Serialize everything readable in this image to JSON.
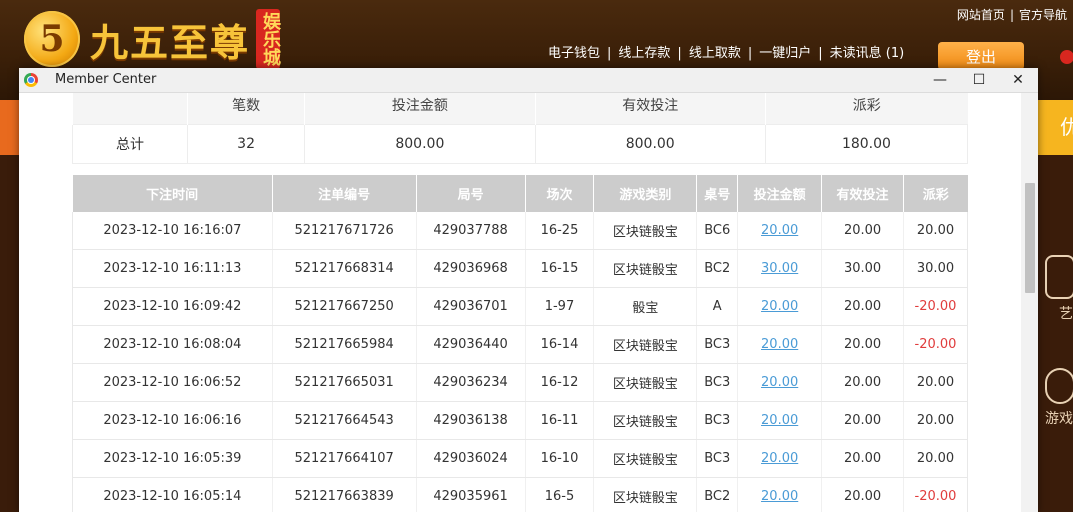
{
  "site": {
    "logo_mark": "5",
    "logo_text": "九五至尊",
    "logo_tag": "娱乐城",
    "top_links": [
      "网站首页",
      "官方导航"
    ],
    "nav_links": [
      "电子钱包",
      "线上存款",
      "线上取款",
      "一键归户",
      "未读讯息 (1)"
    ],
    "logout_label": "登出",
    "side_partial": [
      "艺",
      "游戏"
    ],
    "side_tile_char": "优"
  },
  "window": {
    "title": "Member Center",
    "minimize": "—",
    "maximize": "☐",
    "close": "✕"
  },
  "summary": {
    "headers": [
      "",
      "笔数",
      "投注金额",
      "有效投注",
      "派彩"
    ],
    "row": [
      "总计",
      "32",
      "800.00",
      "800.00",
      "180.00"
    ]
  },
  "bets": {
    "headers": [
      "下注时间",
      "注单编号",
      "局号",
      "场次",
      "游戏类别",
      "桌号",
      "投注金额",
      "有效投注",
      "派彩"
    ],
    "rows": [
      [
        "2023-12-10 16:16:07",
        "521217671726",
        "429037788",
        "16-25",
        "区块链骰宝",
        "BC6",
        "20.00",
        "20.00",
        "20.00"
      ],
      [
        "2023-12-10 16:11:13",
        "521217668314",
        "429036968",
        "16-15",
        "区块链骰宝",
        "BC2",
        "30.00",
        "30.00",
        "30.00"
      ],
      [
        "2023-12-10 16:09:42",
        "521217667250",
        "429036701",
        "1-97",
        "骰宝",
        "A",
        "20.00",
        "20.00",
        "-20.00"
      ],
      [
        "2023-12-10 16:08:04",
        "521217665984",
        "429036440",
        "16-14",
        "区块链骰宝",
        "BC3",
        "20.00",
        "20.00",
        "-20.00"
      ],
      [
        "2023-12-10 16:06:52",
        "521217665031",
        "429036234",
        "16-12",
        "区块链骰宝",
        "BC3",
        "20.00",
        "20.00",
        "20.00"
      ],
      [
        "2023-12-10 16:06:16",
        "521217664543",
        "429036138",
        "16-11",
        "区块链骰宝",
        "BC3",
        "20.00",
        "20.00",
        "20.00"
      ],
      [
        "2023-12-10 16:05:39",
        "521217664107",
        "429036024",
        "16-10",
        "区块链骰宝",
        "BC3",
        "20.00",
        "20.00",
        "20.00"
      ],
      [
        "2023-12-10 16:05:14",
        "521217663839",
        "429035961",
        "16-5",
        "区块链骰宝",
        "BC2",
        "20.00",
        "20.00",
        "-20.00"
      ]
    ]
  },
  "colors": {
    "accent_orange": "#e86a1e",
    "link_blue": "#4a9bd6",
    "negative_red": "#e03c3c",
    "header_gray": "#cccccc"
  }
}
